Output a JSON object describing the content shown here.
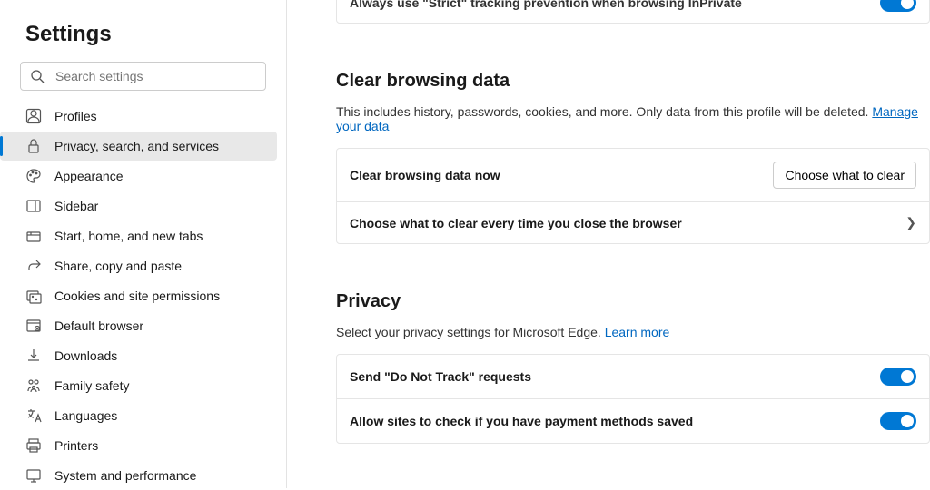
{
  "sidebar": {
    "title": "Settings",
    "searchPlaceholder": "Search settings",
    "items": [
      {
        "label": "Profiles"
      },
      {
        "label": "Privacy, search, and services"
      },
      {
        "label": "Appearance"
      },
      {
        "label": "Sidebar"
      },
      {
        "label": "Start, home, and new tabs"
      },
      {
        "label": "Share, copy and paste"
      },
      {
        "label": "Cookies and site permissions"
      },
      {
        "label": "Default browser"
      },
      {
        "label": "Downloads"
      },
      {
        "label": "Family safety"
      },
      {
        "label": "Languages"
      },
      {
        "label": "Printers"
      },
      {
        "label": "System and performance"
      }
    ]
  },
  "content": {
    "peekRow": {
      "label": "Always use \"Strict\" tracking prevention when browsing InPrivate",
      "toggle": true
    },
    "clearData": {
      "heading": "Clear browsing data",
      "descPrefix": "This includes history, passwords, cookies, and more. Only data from this profile will be deleted. ",
      "descLink": "Manage your data",
      "nowLabel": "Clear browsing data now",
      "nowButton": "Choose what to clear",
      "everyTimeLabel": "Choose what to clear every time you close the browser"
    },
    "privacy": {
      "heading": "Privacy",
      "descPrefix": "Select your privacy settings for Microsoft Edge. ",
      "descLink": "Learn more",
      "dntLabel": "Send \"Do Not Track\" requests",
      "paymentLabel": "Allow sites to check if you have payment methods saved"
    }
  }
}
